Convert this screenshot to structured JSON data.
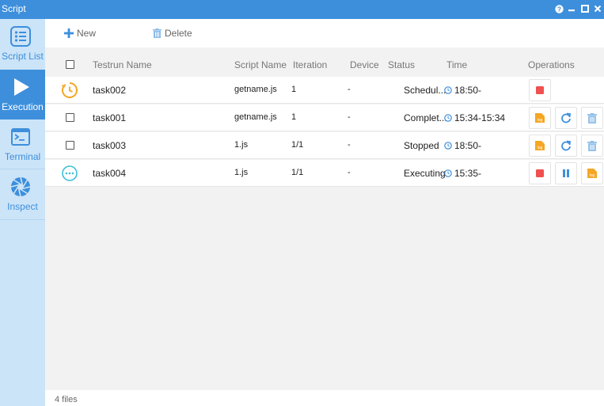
{
  "window": {
    "title": "Script",
    "controls": [
      "help-icon",
      "minimize-icon",
      "maximize-icon",
      "close-icon"
    ]
  },
  "sidebar": {
    "items": [
      {
        "label": "Script List",
        "icon": "list-icon",
        "active": false
      },
      {
        "label": "Execution",
        "icon": "play-icon",
        "active": true
      },
      {
        "label": "Terminal",
        "icon": "terminal-icon",
        "active": false
      },
      {
        "label": "Inspect",
        "icon": "aperture-icon",
        "active": false
      }
    ]
  },
  "toolbar": {
    "new_label": "New",
    "delete_label": "Delete"
  },
  "table": {
    "headers": {
      "name": "Testrun Name",
      "script": "Script Name",
      "iteration": "Iteration",
      "device": "Device",
      "status": "Status",
      "time": "Time",
      "operations": "Operations"
    },
    "rows": [
      {
        "state_icon": "clock-icon",
        "name": "task002",
        "script": "getname.js",
        "iteration": "1",
        "device": "-",
        "status": "Schedul...",
        "time": "18:50-",
        "ops": [
          "stop-icon"
        ]
      },
      {
        "state_icon": "checkbox",
        "name": "task001",
        "script": "getname.js",
        "iteration": "1",
        "device": "-",
        "status": "Complet...",
        "time": "15:34-15:34",
        "ops": [
          "log-icon",
          "rerun-icon",
          "trash-icon"
        ]
      },
      {
        "state_icon": "checkbox",
        "name": "task003",
        "script": "1.js",
        "iteration": "1/1",
        "device": "-",
        "status": "Stopped",
        "time": "18:50-",
        "ops": [
          "log-icon",
          "rerun-icon",
          "trash-icon"
        ]
      },
      {
        "state_icon": "running-icon",
        "name": "task004",
        "script": "1.js",
        "iteration": "1/1",
        "device": "-",
        "status": "Executing",
        "time": "15:35-",
        "ops": [
          "stop-icon",
          "pause-icon",
          "log-icon"
        ]
      }
    ]
  },
  "footer": {
    "count_text": "4 files"
  },
  "colors": {
    "accent": "#3d8fdc",
    "sidebar_bg": "#cce4f8",
    "stop": "#f05050",
    "log": "#f5a623",
    "rerun": "#3d8fdc",
    "trash": "#8cbde8"
  }
}
